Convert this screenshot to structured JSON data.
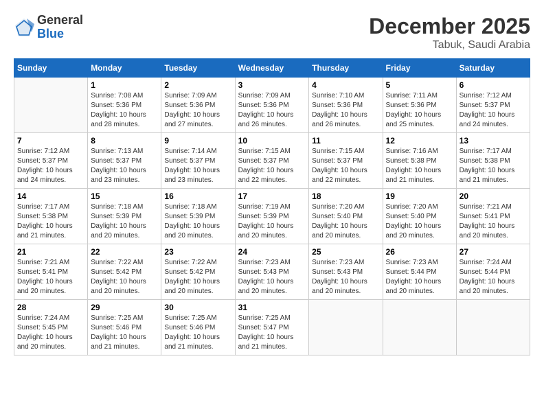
{
  "logo": {
    "general": "General",
    "blue": "Blue"
  },
  "title": {
    "month_year": "December 2025",
    "location": "Tabuk, Saudi Arabia"
  },
  "headers": [
    "Sunday",
    "Monday",
    "Tuesday",
    "Wednesday",
    "Thursday",
    "Friday",
    "Saturday"
  ],
  "weeks": [
    [
      {
        "day": "",
        "info": ""
      },
      {
        "day": "1",
        "info": "Sunrise: 7:08 AM\nSunset: 5:36 PM\nDaylight: 10 hours\nand 28 minutes."
      },
      {
        "day": "2",
        "info": "Sunrise: 7:09 AM\nSunset: 5:36 PM\nDaylight: 10 hours\nand 27 minutes."
      },
      {
        "day": "3",
        "info": "Sunrise: 7:09 AM\nSunset: 5:36 PM\nDaylight: 10 hours\nand 26 minutes."
      },
      {
        "day": "4",
        "info": "Sunrise: 7:10 AM\nSunset: 5:36 PM\nDaylight: 10 hours\nand 26 minutes."
      },
      {
        "day": "5",
        "info": "Sunrise: 7:11 AM\nSunset: 5:36 PM\nDaylight: 10 hours\nand 25 minutes."
      },
      {
        "day": "6",
        "info": "Sunrise: 7:12 AM\nSunset: 5:37 PM\nDaylight: 10 hours\nand 24 minutes."
      }
    ],
    [
      {
        "day": "7",
        "info": "Sunrise: 7:12 AM\nSunset: 5:37 PM\nDaylight: 10 hours\nand 24 minutes."
      },
      {
        "day": "8",
        "info": "Sunrise: 7:13 AM\nSunset: 5:37 PM\nDaylight: 10 hours\nand 23 minutes."
      },
      {
        "day": "9",
        "info": "Sunrise: 7:14 AM\nSunset: 5:37 PM\nDaylight: 10 hours\nand 23 minutes."
      },
      {
        "day": "10",
        "info": "Sunrise: 7:15 AM\nSunset: 5:37 PM\nDaylight: 10 hours\nand 22 minutes."
      },
      {
        "day": "11",
        "info": "Sunrise: 7:15 AM\nSunset: 5:37 PM\nDaylight: 10 hours\nand 22 minutes."
      },
      {
        "day": "12",
        "info": "Sunrise: 7:16 AM\nSunset: 5:38 PM\nDaylight: 10 hours\nand 21 minutes."
      },
      {
        "day": "13",
        "info": "Sunrise: 7:17 AM\nSunset: 5:38 PM\nDaylight: 10 hours\nand 21 minutes."
      }
    ],
    [
      {
        "day": "14",
        "info": "Sunrise: 7:17 AM\nSunset: 5:38 PM\nDaylight: 10 hours\nand 21 minutes."
      },
      {
        "day": "15",
        "info": "Sunrise: 7:18 AM\nSunset: 5:39 PM\nDaylight: 10 hours\nand 20 minutes."
      },
      {
        "day": "16",
        "info": "Sunrise: 7:18 AM\nSunset: 5:39 PM\nDaylight: 10 hours\nand 20 minutes."
      },
      {
        "day": "17",
        "info": "Sunrise: 7:19 AM\nSunset: 5:39 PM\nDaylight: 10 hours\nand 20 minutes."
      },
      {
        "day": "18",
        "info": "Sunrise: 7:20 AM\nSunset: 5:40 PM\nDaylight: 10 hours\nand 20 minutes."
      },
      {
        "day": "19",
        "info": "Sunrise: 7:20 AM\nSunset: 5:40 PM\nDaylight: 10 hours\nand 20 minutes."
      },
      {
        "day": "20",
        "info": "Sunrise: 7:21 AM\nSunset: 5:41 PM\nDaylight: 10 hours\nand 20 minutes."
      }
    ],
    [
      {
        "day": "21",
        "info": "Sunrise: 7:21 AM\nSunset: 5:41 PM\nDaylight: 10 hours\nand 20 minutes."
      },
      {
        "day": "22",
        "info": "Sunrise: 7:22 AM\nSunset: 5:42 PM\nDaylight: 10 hours\nand 20 minutes."
      },
      {
        "day": "23",
        "info": "Sunrise: 7:22 AM\nSunset: 5:42 PM\nDaylight: 10 hours\nand 20 minutes."
      },
      {
        "day": "24",
        "info": "Sunrise: 7:23 AM\nSunset: 5:43 PM\nDaylight: 10 hours\nand 20 minutes."
      },
      {
        "day": "25",
        "info": "Sunrise: 7:23 AM\nSunset: 5:43 PM\nDaylight: 10 hours\nand 20 minutes."
      },
      {
        "day": "26",
        "info": "Sunrise: 7:23 AM\nSunset: 5:44 PM\nDaylight: 10 hours\nand 20 minutes."
      },
      {
        "day": "27",
        "info": "Sunrise: 7:24 AM\nSunset: 5:44 PM\nDaylight: 10 hours\nand 20 minutes."
      }
    ],
    [
      {
        "day": "28",
        "info": "Sunrise: 7:24 AM\nSunset: 5:45 PM\nDaylight: 10 hours\nand 20 minutes."
      },
      {
        "day": "29",
        "info": "Sunrise: 7:25 AM\nSunset: 5:46 PM\nDaylight: 10 hours\nand 21 minutes."
      },
      {
        "day": "30",
        "info": "Sunrise: 7:25 AM\nSunset: 5:46 PM\nDaylight: 10 hours\nand 21 minutes."
      },
      {
        "day": "31",
        "info": "Sunrise: 7:25 AM\nSunset: 5:47 PM\nDaylight: 10 hours\nand 21 minutes."
      },
      {
        "day": "",
        "info": ""
      },
      {
        "day": "",
        "info": ""
      },
      {
        "day": "",
        "info": ""
      }
    ]
  ]
}
